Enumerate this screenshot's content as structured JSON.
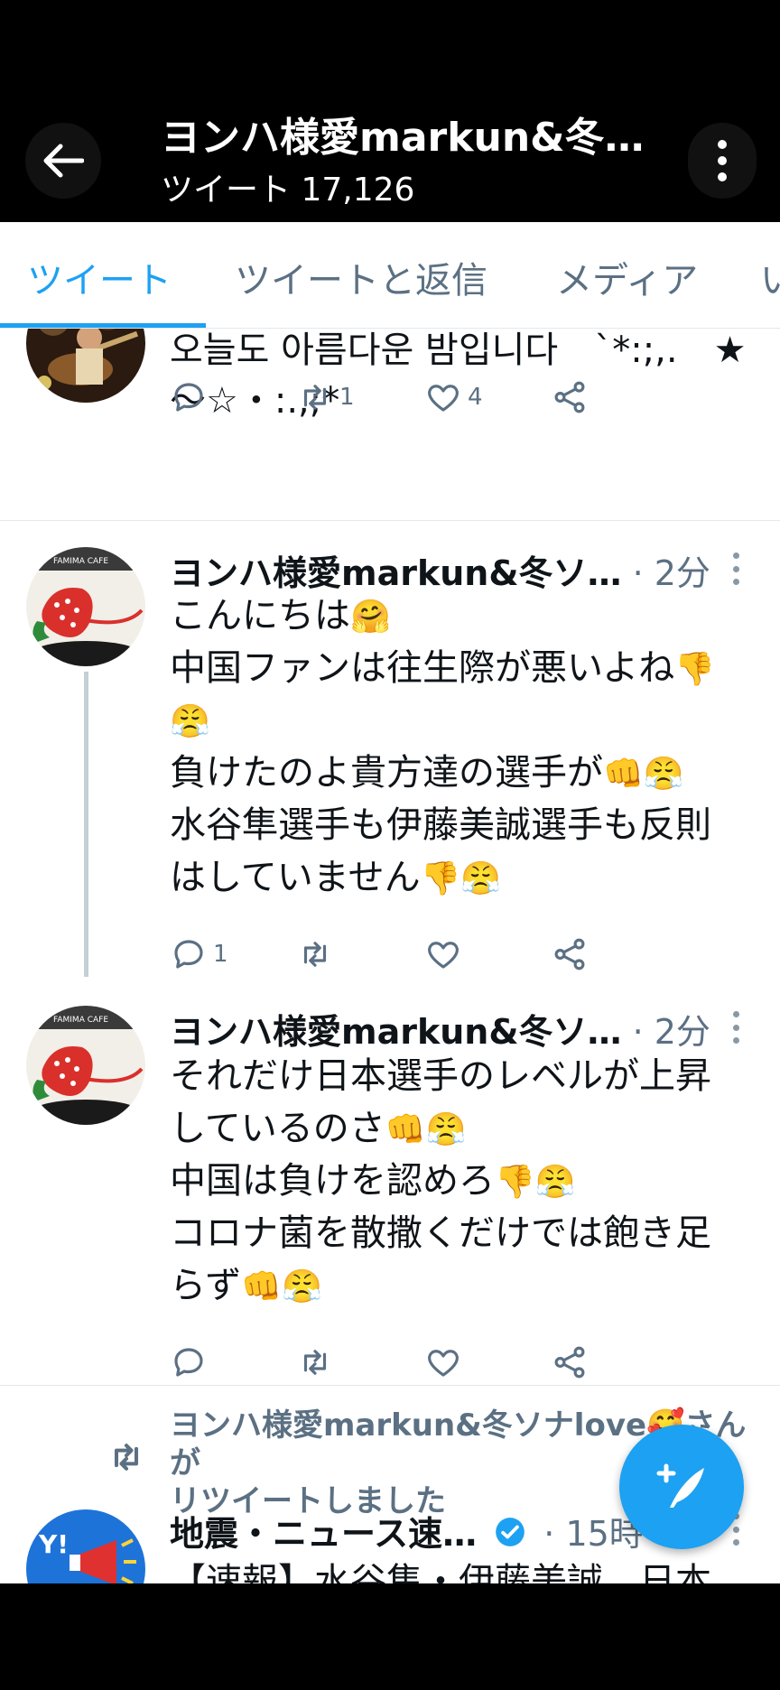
{
  "header": {
    "title": "ヨンハ様愛markun&冬…",
    "subtitle": "ツイート 17,126"
  },
  "tabs": [
    {
      "label": "ツイート",
      "active": true
    },
    {
      "label": "ツイートと返信",
      "active": false
    },
    {
      "label": "メディア",
      "active": false
    },
    {
      "label": "い",
      "active": false
    }
  ],
  "tweets": [
    {
      "lines": [
        "오늘도 아름다운 밤입니다　`*:;,.　★",
        "〜☆・:.,;*"
      ],
      "reply_count": "",
      "retweet_count": "1",
      "like_count": "4"
    },
    {
      "name": "ヨンハ様愛markun&冬ソ…",
      "time": "· 2分",
      "lines": [
        [
          "こんにちは",
          "🤗"
        ],
        [
          "中国ファンは往生際が悪いよね",
          "👎"
        ],
        [
          "",
          "😤"
        ],
        [
          "負けたのよ貴方達の選手が",
          "👊😤"
        ],
        [
          "水谷隼選手も伊藤美誠選手も反則",
          ""
        ],
        [
          "はしていません",
          "👎😤"
        ]
      ],
      "reply_count": "1",
      "retweet_count": "",
      "like_count": ""
    },
    {
      "name": "ヨンハ様愛markun&冬ソ…",
      "time": "· 2分",
      "lines": [
        [
          "それだけ日本選手のレベルが上昇",
          ""
        ],
        [
          "しているのさ",
          "👊😤"
        ],
        [
          "中国は負けを認めろ",
          "👎😤"
        ],
        [
          "コロナ菌を散撒くだけでは飽き足",
          ""
        ],
        [
          "らず",
          "👊😤"
        ]
      ],
      "reply_count": "",
      "retweet_count": "",
      "like_count": ""
    }
  ],
  "retweet_notice": {
    "line1": "ヨンハ様愛markun&冬ソナlove🥰さんが",
    "line2": "リツイートしました"
  },
  "next_tweet": {
    "name": "地震・ニュース速…",
    "time": "· 15時",
    "text": "【速報】水谷隼・伊藤美誠、日本"
  },
  "colors": {
    "accent": "#1da1f2",
    "text_secondary": "#5b7083",
    "divider": "#e1e8ed"
  }
}
